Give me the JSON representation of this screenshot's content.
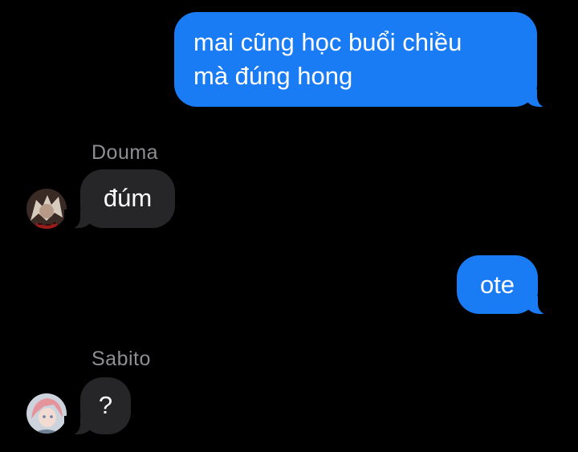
{
  "messages": [
    {
      "direction": "outgoing",
      "lines": [
        "mai cũng học buổi chiều",
        "mà đúng hong"
      ]
    },
    {
      "direction": "incoming",
      "sender": "Douma",
      "text": "đúm",
      "avatar_icon": "douma-avatar-icon"
    },
    {
      "direction": "outgoing",
      "text": "ote"
    },
    {
      "direction": "incoming",
      "sender": "Sabito",
      "text": "?",
      "avatar_icon": "sabito-avatar-icon"
    }
  ],
  "colors": {
    "background": "#000000",
    "outgoing_bubble": "#1a7cf5",
    "incoming_bubble": "#262628",
    "sender_name": "#8e8e93"
  }
}
